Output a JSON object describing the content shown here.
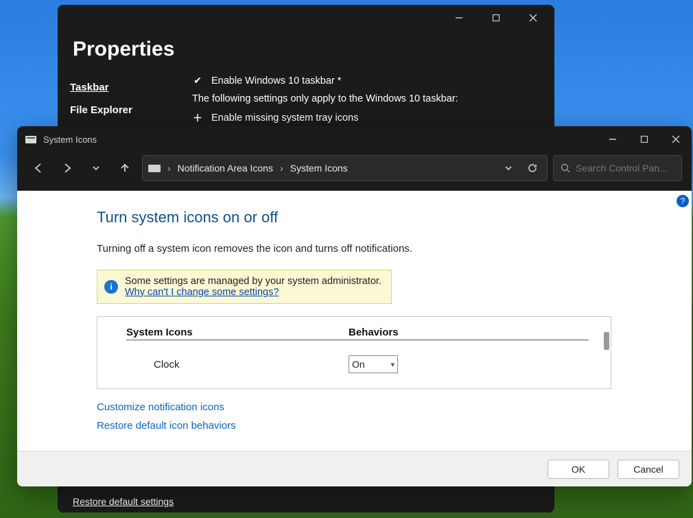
{
  "properties_window": {
    "title": "Properties",
    "sidebar": {
      "items": [
        {
          "label": "Taskbar",
          "active": true
        },
        {
          "label": "File Explorer",
          "active": false
        }
      ]
    },
    "options": {
      "row1": "Enable Windows 10 taskbar *",
      "desc": "The following settings only apply to the Windows 10 taskbar:",
      "row2": "Enable missing system tray icons"
    },
    "restore_link": "Restore default settings"
  },
  "system_icons_window": {
    "title": "System Icons",
    "breadcrumb": {
      "crumb1": "Notification Area Icons",
      "crumb2": "System Icons"
    },
    "search_placeholder": "Search Control Pan...",
    "page": {
      "heading": "Turn system icons on or off",
      "description": "Turning off a system icon removes the icon and turns off notifications.",
      "info_line1": "Some settings are managed by your system administrator.",
      "info_link": "Why can't I change some settings?",
      "col_name": "System Icons",
      "col_behavior": "Behaviors",
      "rows": [
        {
          "name": "Clock",
          "behavior": "On"
        }
      ],
      "customize_link": "Customize notification icons",
      "restore_link": "Restore default icon behaviors"
    },
    "buttons": {
      "ok": "OK",
      "cancel": "Cancel"
    }
  }
}
